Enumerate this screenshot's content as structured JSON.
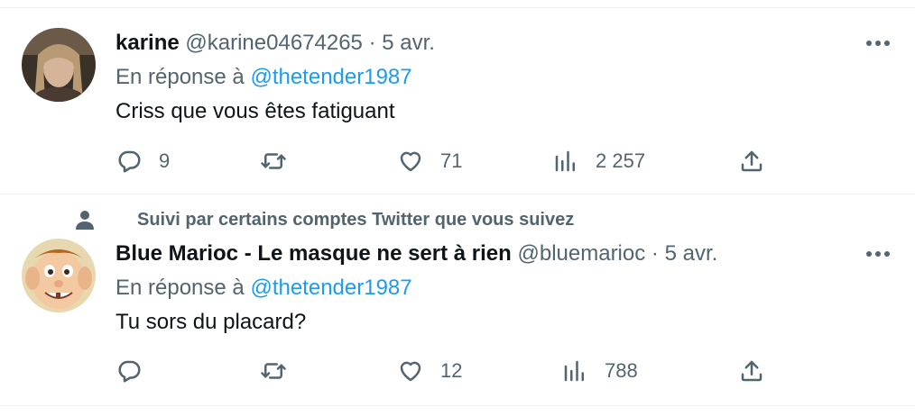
{
  "tweets": [
    {
      "name": "karine",
      "handle": "@karine04674265",
      "separator": "·",
      "date": "5 avr.",
      "reply_prefix": "En réponse à",
      "reply_mention": "@thetender1987",
      "text": "Criss que vous êtes fatiguant",
      "replies": "9",
      "retweets": "",
      "likes": "71",
      "views": "2 257"
    },
    {
      "social_context": "Suivi par certains comptes Twitter que vous suivez",
      "name": "Blue Marioc - Le masque ne sert à rien",
      "handle": "@bluemarioc",
      "separator": "·",
      "date": "5 avr.",
      "reply_prefix": "En réponse à",
      "reply_mention": "@thetender1987",
      "text": "Tu sors du placard?",
      "replies": "",
      "retweets": "",
      "likes": "12",
      "views": "788"
    }
  ],
  "colors": {
    "text": "#0f1419",
    "secondary": "#536471",
    "link": "#1d9bf0",
    "divider": "#eff3f4"
  }
}
